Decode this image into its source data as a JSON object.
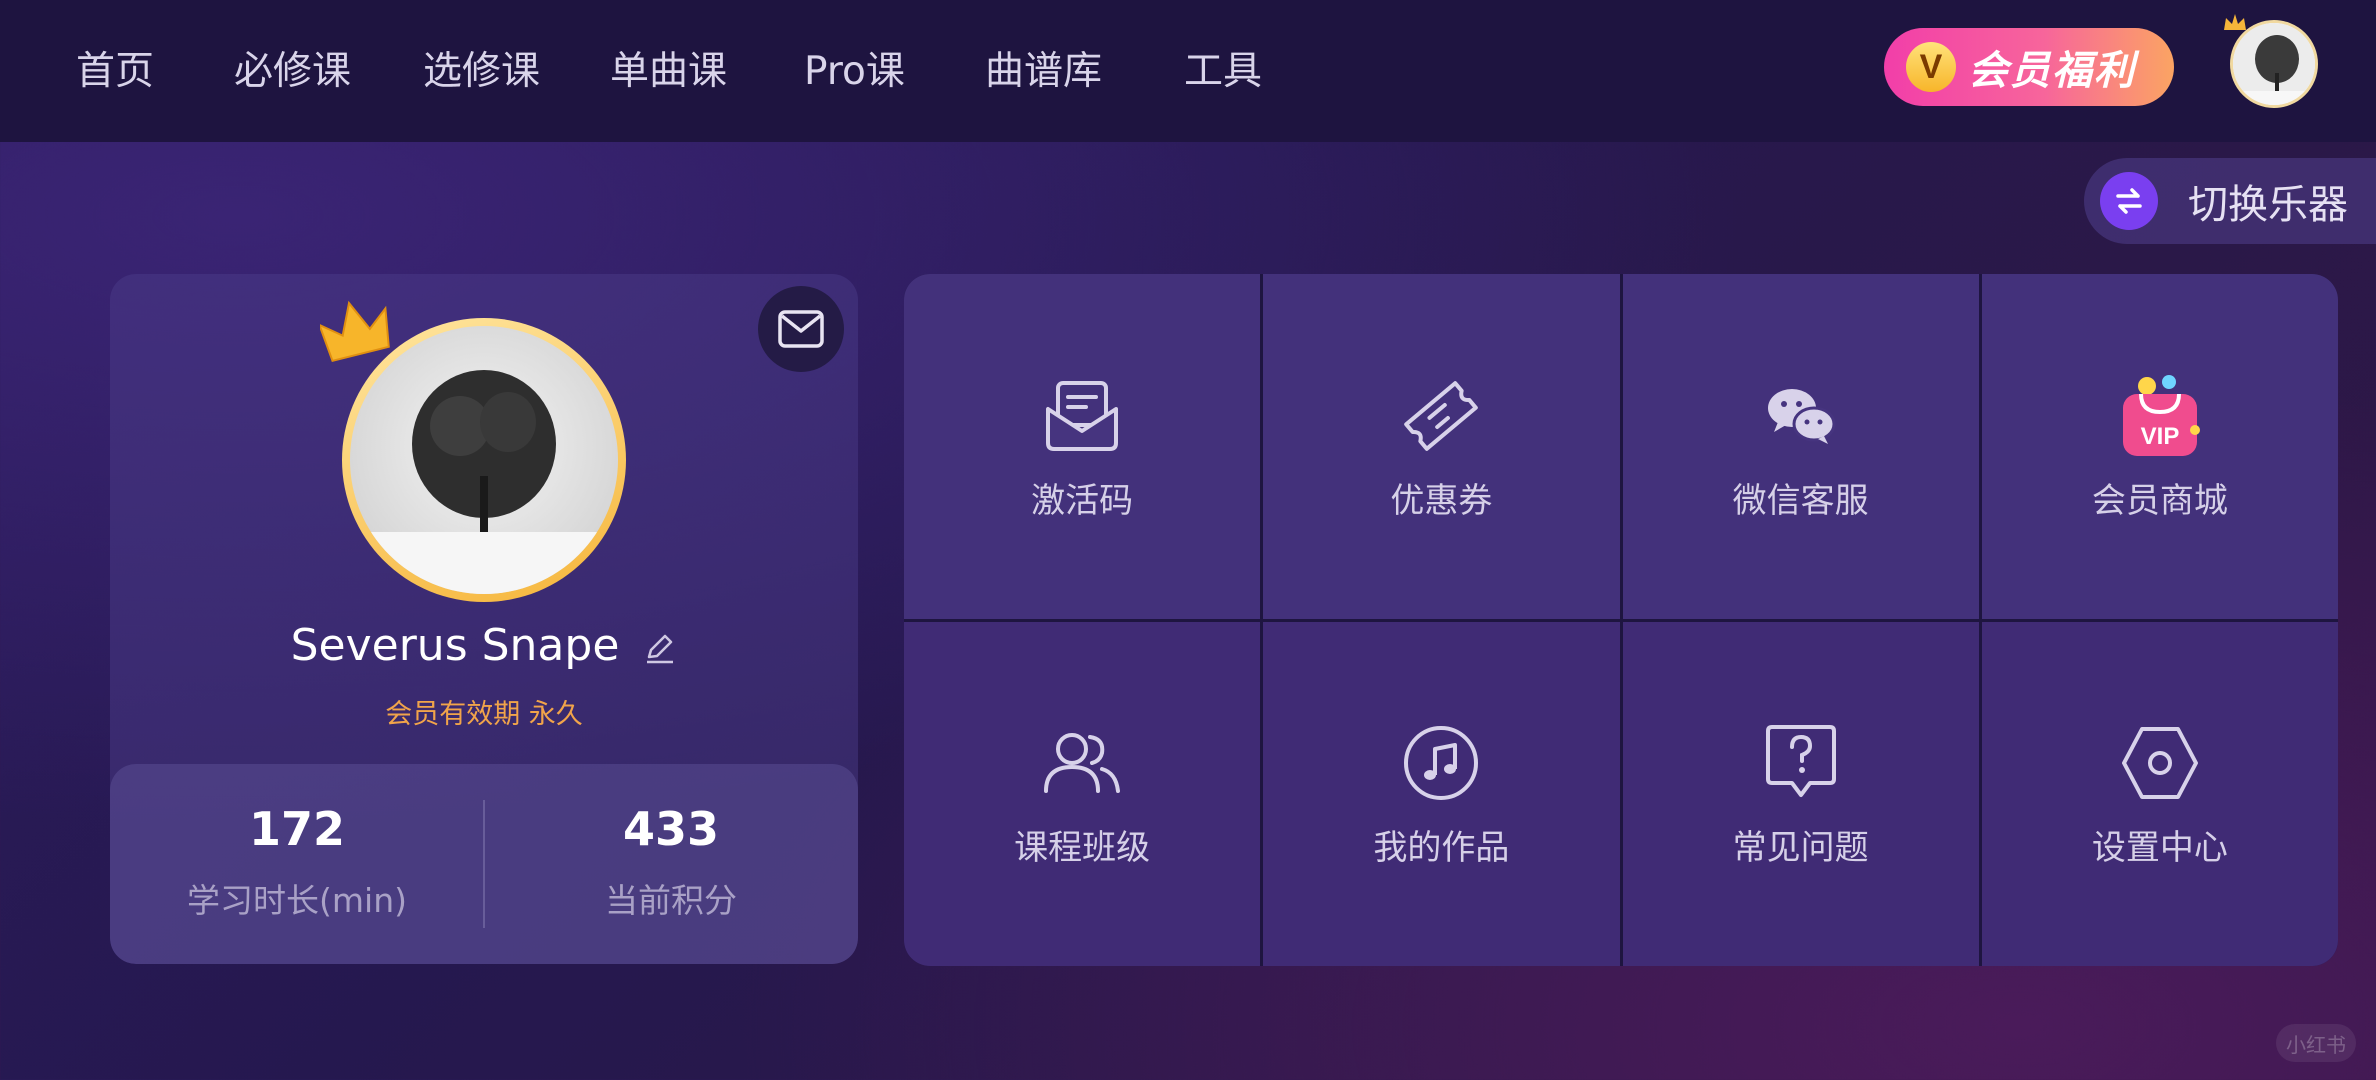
{
  "nav": {
    "items": [
      "首页",
      "必修课",
      "选修课",
      "单曲课",
      "Pro课",
      "曲谱库",
      "工具"
    ]
  },
  "header": {
    "vip_button_label": "会员福利",
    "vip_badge": "V"
  },
  "switch_instrument": {
    "label": "切换乐器"
  },
  "profile": {
    "username": "Severus Snape",
    "membership_label": "会员有效期",
    "membership_value": "永久",
    "stats": [
      {
        "value": "172",
        "label": "学习时长(min)"
      },
      {
        "value": "433",
        "label": "当前积分"
      }
    ]
  },
  "grid": {
    "tiles": [
      {
        "label": "激活码",
        "icon": "activation-code-icon"
      },
      {
        "label": "优惠券",
        "icon": "coupon-icon"
      },
      {
        "label": "微信客服",
        "icon": "wechat-icon"
      },
      {
        "label": "会员商城",
        "icon": "vip-mall-icon",
        "icon_text": "VIP"
      },
      {
        "label": "课程班级",
        "icon": "class-users-icon"
      },
      {
        "label": "我的作品",
        "icon": "music-note-icon"
      },
      {
        "label": "常见问题",
        "icon": "faq-icon"
      },
      {
        "label": "设置中心",
        "icon": "settings-hexagon-icon"
      }
    ]
  },
  "watermark": "小红书",
  "colors": {
    "accent_gold": "#f1a44a",
    "vip_gradient_start": "#f23ea9",
    "vip_gradient_end": "#fba463",
    "switch_purple": "#7a3ff0"
  }
}
